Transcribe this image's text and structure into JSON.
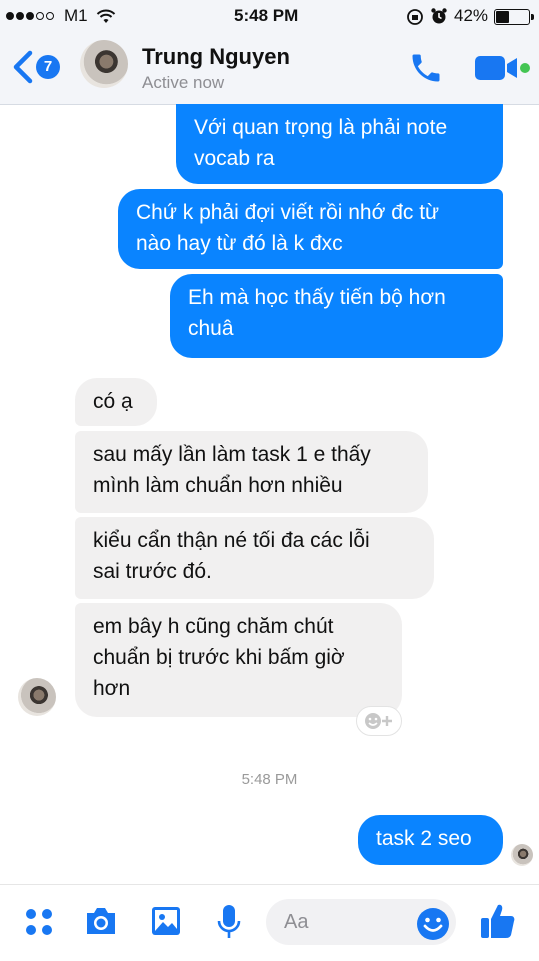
{
  "status_bar": {
    "carrier": "M1",
    "time": "5:48 PM",
    "battery": "42%",
    "battery_level": 0.42,
    "signal_bars_filled": 3,
    "signal_bars_total": 5
  },
  "header": {
    "unread_count": "7",
    "contact_name": "Trung Nguyen",
    "contact_status": "Active now",
    "icons": [
      "back-chevron-icon",
      "phone-icon",
      "video-camera-icon",
      "active-dot-icon"
    ]
  },
  "messages": [
    {
      "from": "me",
      "text": "Với quan trọng là phải note\nvocab ra"
    },
    {
      "from": "me",
      "text": "Chứ k phải đợi viết rồi nhớ đc từ\nnào hay từ đó là k đxc"
    },
    {
      "from": "me",
      "text": "Eh mà học thấy tiến bộ hơn\nchuâ"
    },
    {
      "from": "them",
      "text": "có ạ"
    },
    {
      "from": "them",
      "text": "sau mấy lần làm task 1 e thấy\nmình làm chuẩn hơn nhiều"
    },
    {
      "from": "them",
      "text": "kiểu cẩn thận né tối đa các lỗi\nsai trước đó."
    },
    {
      "from": "them",
      "text": "em bây h cũng chăm chút\nchuẩn bị trước khi bấm giờ\nhơn"
    },
    {
      "from": "me",
      "text": "task 2 seo"
    }
  ],
  "timestamp": "5:48 PM",
  "composer": {
    "placeholder": "Aa",
    "icons": [
      "apps-icon",
      "camera-icon",
      "image-icon",
      "microphone-icon",
      "emoji-icon",
      "thumbs-up-icon"
    ]
  },
  "colors": {
    "accent": "#0a84ff",
    "incoming_bubble": "#f1f0f0",
    "active_dot": "#44c553"
  }
}
